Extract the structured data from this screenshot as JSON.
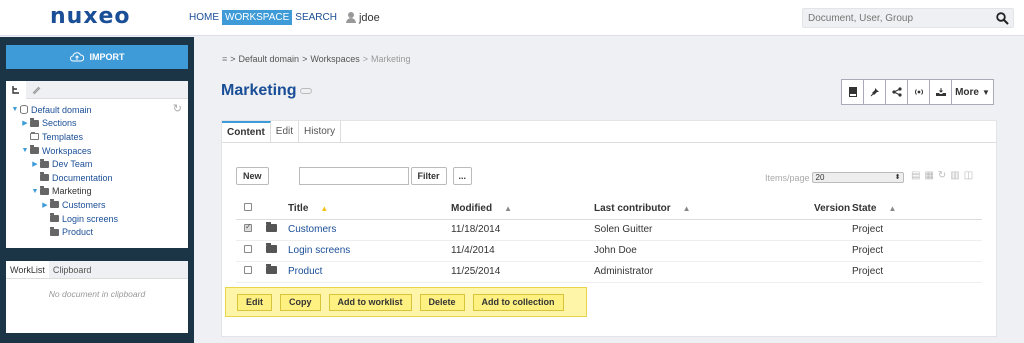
{
  "app": {
    "logo": "nuxeo"
  },
  "topnav": {
    "items": [
      "HOME",
      "WORKSPACE",
      "SEARCH"
    ],
    "active": "WORKSPACE",
    "user": "jdoe",
    "search_placeholder": "Document, User, Group"
  },
  "sidebar": {
    "import_label": "IMPORT",
    "tree": [
      {
        "label": "Default domain",
        "level": 0,
        "arrow": "down",
        "icon": "database-icon"
      },
      {
        "label": "Sections",
        "level": 1,
        "arrow": "right",
        "icon": "folder-icon"
      },
      {
        "label": "Templates",
        "level": 1,
        "arrow": "",
        "icon": "folder-outline-icon"
      },
      {
        "label": "Workspaces",
        "level": 1,
        "arrow": "down",
        "icon": "folder-icon"
      },
      {
        "label": "Dev Team",
        "level": 2,
        "arrow": "right",
        "icon": "folder-icon"
      },
      {
        "label": "Documentation",
        "level": 2,
        "arrow": "",
        "icon": "folder-icon"
      },
      {
        "label": "Marketing",
        "level": 2,
        "arrow": "down",
        "icon": "folder-icon",
        "selected": true
      },
      {
        "label": "Customers",
        "level": 3,
        "arrow": "right",
        "icon": "folder-icon"
      },
      {
        "label": "Login screens",
        "level": 3,
        "arrow": "",
        "icon": "folder-icon"
      },
      {
        "label": "Product",
        "level": 3,
        "arrow": "",
        "icon": "folder-icon"
      }
    ],
    "worklist_tabs": [
      "WorkList",
      "Clipboard"
    ],
    "clipboard_empty": "No document in clipboard"
  },
  "breadcrumb": {
    "root": "Default domain",
    "parent": "Workspaces",
    "current": "Marketing"
  },
  "page": {
    "title": "Marketing",
    "more_label": "More"
  },
  "tabs": [
    "Content",
    "Edit",
    "History"
  ],
  "content": {
    "new_label": "New",
    "filter_label": "Filter",
    "more_filter_label": "...",
    "items_per_page_label": "Items/page",
    "items_per_page_value": "20",
    "columns": [
      "Title",
      "Modified",
      "Last contributor",
      "Version",
      "State"
    ],
    "rows": [
      {
        "title": "Customers",
        "modified": "11/18/2014",
        "contributor": "Solen Guitter",
        "version": "",
        "state": "Project",
        "checked": true
      },
      {
        "title": "Login screens",
        "modified": "11/4/2014",
        "contributor": "John Doe",
        "version": "",
        "state": "Project",
        "checked": false
      },
      {
        "title": "Product",
        "modified": "11/25/2014",
        "contributor": "Administrator",
        "version": "",
        "state": "Project",
        "checked": false
      }
    ],
    "selection_actions": [
      "Edit",
      "Copy",
      "Add to worklist",
      "Delete",
      "Add to collection"
    ]
  },
  "colors": {
    "brand": "#1a4e96",
    "accent": "#3e9bd8",
    "sidebar_bg": "#1b3547",
    "selection_bg": "#fff5a8"
  }
}
